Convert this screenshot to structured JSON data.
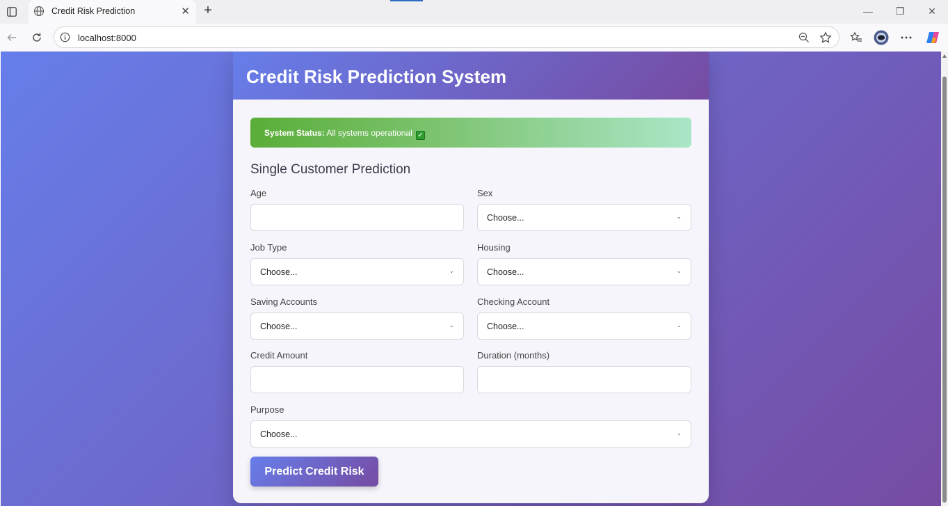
{
  "browser": {
    "tab_title": "Credit Risk Prediction",
    "tab_close": "✕",
    "new_tab": "+",
    "url": "localhost:8000",
    "window_controls": {
      "minimize": "—",
      "restore": "❐",
      "close": "✕"
    }
  },
  "header": {
    "title": "Credit Risk Prediction System"
  },
  "status": {
    "label": "System Status:",
    "text": "All systems operational",
    "check": "✓",
    "color": "#5aad38"
  },
  "form": {
    "title": "Single Customer Prediction",
    "age": {
      "label": "Age",
      "value": ""
    },
    "sex": {
      "label": "Sex",
      "value": "Choose..."
    },
    "job_type": {
      "label": "Job Type",
      "value": "Choose..."
    },
    "housing": {
      "label": "Housing",
      "value": "Choose..."
    },
    "saving_accounts": {
      "label": "Saving Accounts",
      "value": "Choose..."
    },
    "checking_account": {
      "label": "Checking Account",
      "value": "Choose..."
    },
    "credit_amount": {
      "label": "Credit Amount",
      "value": ""
    },
    "duration": {
      "label": "Duration (months)",
      "value": ""
    },
    "purpose": {
      "label": "Purpose",
      "value": "Choose..."
    },
    "submit_label": "Predict Credit Risk"
  },
  "theme": {
    "gradient_start": "#667eea",
    "gradient_end": "#764ba2"
  }
}
